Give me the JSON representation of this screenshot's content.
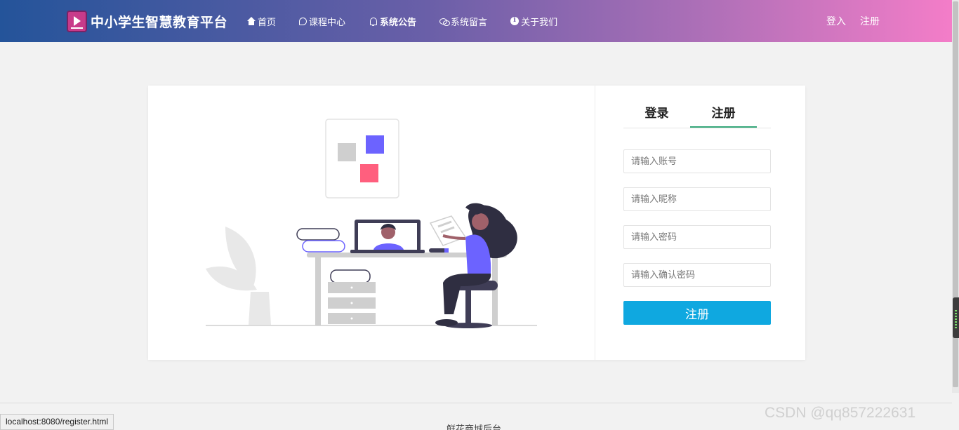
{
  "header": {
    "brand_title": "中小学生智慧教育平台",
    "nav": [
      {
        "label": "首页",
        "icon": "home-icon"
      },
      {
        "label": "课程中心",
        "icon": "chat-icon"
      },
      {
        "label": "系统公告",
        "icon": "bell-icon"
      },
      {
        "label": "系统留言",
        "icon": "comments-icon"
      },
      {
        "label": "关于我们",
        "icon": "info-icon"
      }
    ],
    "login_link": "登入",
    "register_link": "注册"
  },
  "form": {
    "tabs": [
      {
        "label": "登录",
        "active": false
      },
      {
        "label": "注册",
        "active": true
      }
    ],
    "account_placeholder": "请输入账号",
    "nickname_placeholder": "请输入昵称",
    "password_placeholder": "请输入密码",
    "confirm_placeholder": "请输入确认密码",
    "submit_label": "注册"
  },
  "footer": {
    "text": "鲜花商城后台"
  },
  "status_bar": {
    "url": "localhost:8080/register.html"
  },
  "watermark": "CSDN @qq857222631",
  "colors": {
    "header_start": "#24549a",
    "header_end": "#f47dc8",
    "active_tab_underline": "#36a87a",
    "submit_button": "#0fa8e0"
  }
}
